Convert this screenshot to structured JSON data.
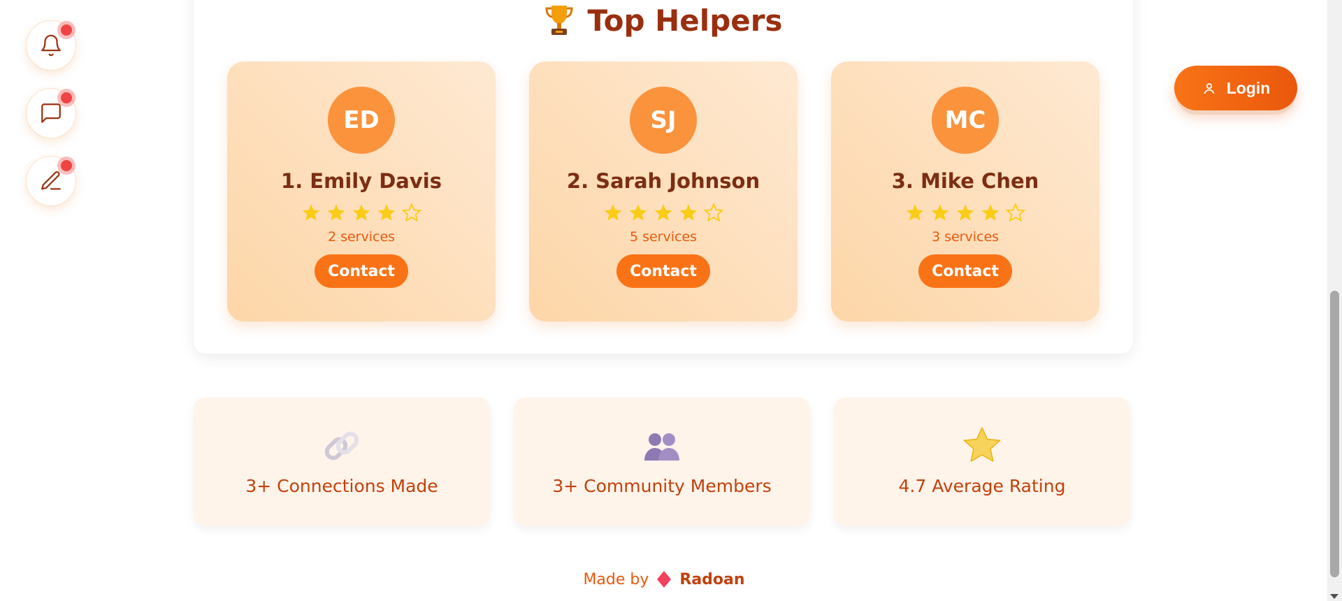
{
  "fabs": [
    {
      "icon": "bell-icon",
      "has_notification": true
    },
    {
      "icon": "message-icon",
      "has_notification": true
    },
    {
      "icon": "pen-icon",
      "has_notification": true
    }
  ],
  "header": {
    "login_label": "Login",
    "login_icon": "user-icon"
  },
  "top_helpers": {
    "title": "Top Helpers",
    "title_icon": "trophy-icon",
    "helpers": [
      {
        "initials": "ED",
        "name": "1. Emily Davis",
        "rating": 4,
        "max_rating": 5,
        "services": "2 services",
        "contact_label": "Contact"
      },
      {
        "initials": "SJ",
        "name": "2. Sarah Johnson",
        "rating": 4,
        "max_rating": 5,
        "services": "5 services",
        "contact_label": "Contact"
      },
      {
        "initials": "MC",
        "name": "3. Mike Chen",
        "rating": 4,
        "max_rating": 5,
        "services": "3 services",
        "contact_label": "Contact"
      }
    ]
  },
  "stats": [
    {
      "icon": "link-icon",
      "label": "3+ Connections Made"
    },
    {
      "icon": "people-icon",
      "label": "3+ Community Members"
    },
    {
      "icon": "star-icon",
      "label": "4.7 Average Rating"
    }
  ],
  "footer": {
    "made_by": "Made by",
    "brand_icon": "diamond-icon",
    "brand": "Radoan"
  },
  "colors": {
    "accent": "#f97316",
    "title": "#9a2f10",
    "notification": "#ef4444",
    "star": "#facc15"
  }
}
